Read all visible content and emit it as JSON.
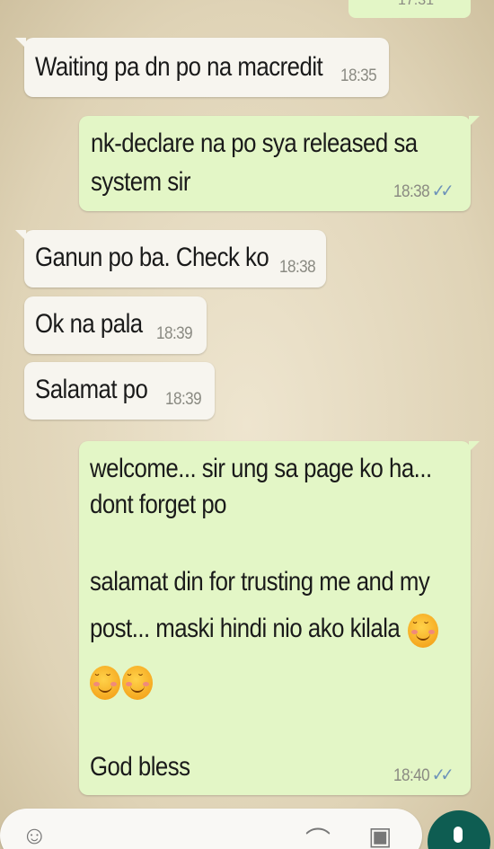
{
  "top_message": {
    "time": "17:31"
  },
  "messages": [
    {
      "text": "Waiting pa dn po na macredit",
      "time": "18:35"
    },
    {
      "lines": [
        "nk-declare na po sya released sa",
        "system sir"
      ],
      "time": "18:38"
    },
    {
      "text": "Ganun po ba. Check ko",
      "time": "18:38"
    },
    {
      "text": "Ok na pala",
      "time": "18:39"
    },
    {
      "text": "Salamat po",
      "time": "18:39"
    },
    {
      "lines": [
        "welcome... sir ung sa page ko ha...",
        "dont forget po",
        "salamat din for trusting me and my",
        "post... maski hindi nio ako kilala",
        "God bless"
      ],
      "time": "18:40"
    }
  ],
  "ticks": "✓✓",
  "colors": {
    "incoming": "#f7f5ef",
    "outgoing": "#e3f6c6",
    "ticks": "#6d93b9",
    "send": "#0e5d52"
  }
}
